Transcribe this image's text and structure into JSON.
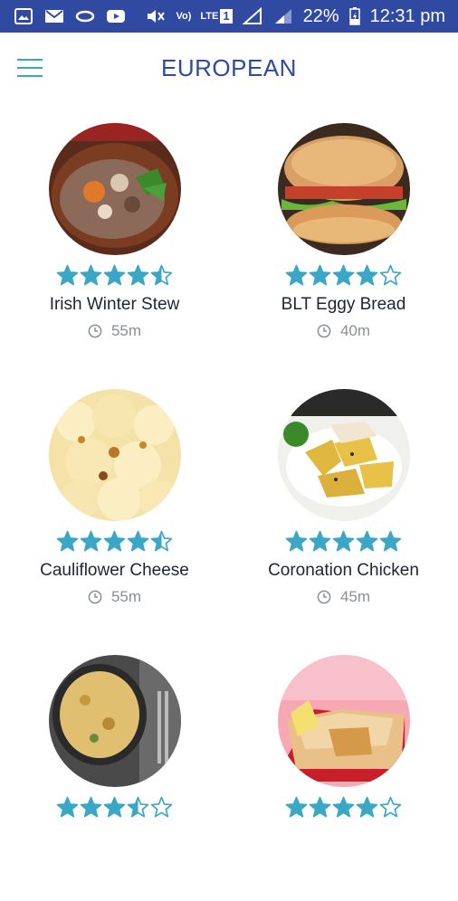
{
  "status_bar": {
    "battery_percent": "22%",
    "time": "12:31 pm",
    "network_label_1": "Vo)",
    "network_label_2": "LTE",
    "sim_number": "1"
  },
  "header": {
    "title": "EUROPEAN"
  },
  "colors": {
    "status_bar": "#2f4aa0",
    "title": "#2f4aa0",
    "accent": "#3aa7c6",
    "text": "#1f2433",
    "muted": "#8a8f96"
  },
  "recipes": [
    {
      "name": "Irish Winter Stew",
      "time": "55m",
      "rating": 4.5,
      "image": "stew"
    },
    {
      "name": "BLT Eggy Bread",
      "time": "40m",
      "rating": 4.0,
      "image": "sandwich"
    },
    {
      "name": "Cauliflower Cheese",
      "time": "55m",
      "rating": 4.5,
      "image": "cauliflower"
    },
    {
      "name": "Coronation Chicken",
      "time": "45m",
      "rating": 5.0,
      "image": "chicken"
    },
    {
      "name": "",
      "time": "",
      "rating": 3.5,
      "image": "frittata"
    },
    {
      "name": "",
      "time": "",
      "rating": 4.0,
      "image": "pastry"
    }
  ]
}
